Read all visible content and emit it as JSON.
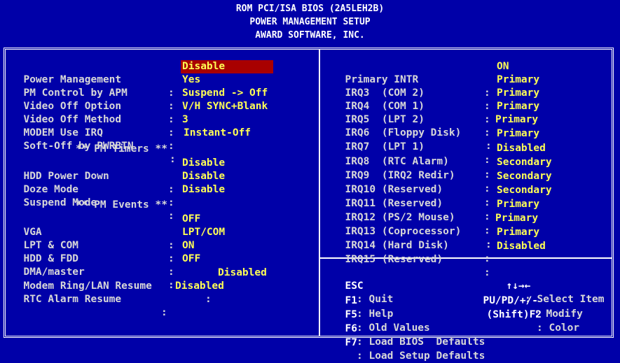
{
  "header": {
    "line1": "ROM PCI/ISA BIOS (2A5LEH2B)",
    "line2": "POWER MANAGEMENT SETUP",
    "line3": "AWARD SOFTWARE, INC."
  },
  "left": {
    "power_management": {
      "label": "Power Management",
      "sep": ":",
      "value": "Disable"
    },
    "pm_control_apm": {
      "label": "PM Control by APM",
      "sep": ":",
      "value": "Yes"
    },
    "video_off_option": {
      "label": "Video Off Option",
      "sep": ":",
      "value": "Suspend -> Off"
    },
    "video_off_method": {
      "label": "Video Off Method",
      "sep": ":",
      "value": "V/H SYNC+Blank"
    },
    "modem_use_irq": {
      "label": "MODEM Use IRQ",
      "sep": ":",
      "value": "3"
    },
    "soft_off": {
      "label": "Soft-Off by PWRBTN",
      "sep": ":",
      "value": "Instant-Off"
    },
    "pm_timers_header": "** PM Timers **",
    "hdd_power_down": {
      "label": "HDD Power Down",
      "sep": ":",
      "value": "Disable"
    },
    "doze_mode": {
      "label": "Doze Mode",
      "sep": ":",
      "value": "Disable"
    },
    "suspend_mode": {
      "label": "Suspend Mode",
      "sep": ":",
      "value": "Disable"
    },
    "pm_events_header": "** PM Events **",
    "vga": {
      "label": "VGA",
      "sep": ":",
      "value": "OFF"
    },
    "lpt_com": {
      "label": "LPT & COM",
      "sep": ":",
      "value": "LPT/COM"
    },
    "hdd_fdd": {
      "label": "HDD & FDD",
      "sep": ":",
      "value": "ON"
    },
    "dma_master": {
      "label": "DMA/master",
      "sep": ":",
      "value": "OFF"
    },
    "modem_ring": {
      "label": "Modem Ring/LAN Resume",
      "sep": ":",
      "value": "Disabled"
    },
    "rtc_alarm": {
      "label": "RTC Alarm Resume",
      "sep": ":",
      "value": "Disabled"
    }
  },
  "right": {
    "primary_intr": {
      "label": "Primary INTR",
      "sep": ":",
      "value": "ON"
    },
    "irqs": [
      {
        "label": "IRQ3  (COM 2)",
        "sep": ":",
        "value": "Primary"
      },
      {
        "label": "IRQ4  (COM 1)",
        "sep": ":",
        "value": "Primary"
      },
      {
        "label": "IRQ5  (LPT 2)",
        "sep": ":",
        "value": "Primary"
      },
      {
        "label": "IRQ6  (Floppy Disk)",
        "sep": ":",
        "value": "Primary"
      },
      {
        "label": "IRQ7  (LPT 1)",
        "sep": ":",
        "value": "Primary"
      },
      {
        "label": "IRQ8  (RTC Alarm)",
        "sep": ":",
        "value": "Disabled"
      },
      {
        "label": "IRQ9  (IRQ2 Redir)",
        "sep": ":",
        "value": "Secondary"
      },
      {
        "label": "IRQ10 (Reserved)",
        "sep": ":",
        "value": "Secondary"
      },
      {
        "label": "IRQ11 (Reserved)",
        "sep": ":",
        "value": "Secondary"
      },
      {
        "label": "IRQ12 (PS/2 Mouse)",
        "sep": ":",
        "value": "Primary"
      },
      {
        "label": "IRQ13 (Coprocessor)",
        "sep": ":",
        "value": "Primary"
      },
      {
        "label": "IRQ14 (Hard Disk)",
        "sep": ":",
        "value": "Primary"
      },
      {
        "label": "IRQ15 (Reserved)",
        "sep": ":",
        "value": "Disabled"
      }
    ]
  },
  "help": {
    "esc": {
      "key": "ESC",
      "text": ": Quit"
    },
    "select": {
      "key": "↑↓→←",
      "text": ": Select Item"
    },
    "f1": {
      "key": "F1",
      "text": ": Help"
    },
    "modify": {
      "key": "PU/PD/+/-",
      "text": ": Modify"
    },
    "f5": {
      "key": "F5",
      "text": ": Old Values"
    },
    "color": {
      "key": "(Shift)F2",
      "text": ": Color"
    },
    "f6": {
      "key": "F6",
      "text": ": Load BIOS  Defaults"
    },
    "f7": {
      "key": "F7",
      "text": ": Load Setup Defaults"
    }
  },
  "colors": {
    "background": "#0000a8",
    "value": "#ffff55",
    "label": "#d8d8d8",
    "highlight": "#a80000"
  }
}
